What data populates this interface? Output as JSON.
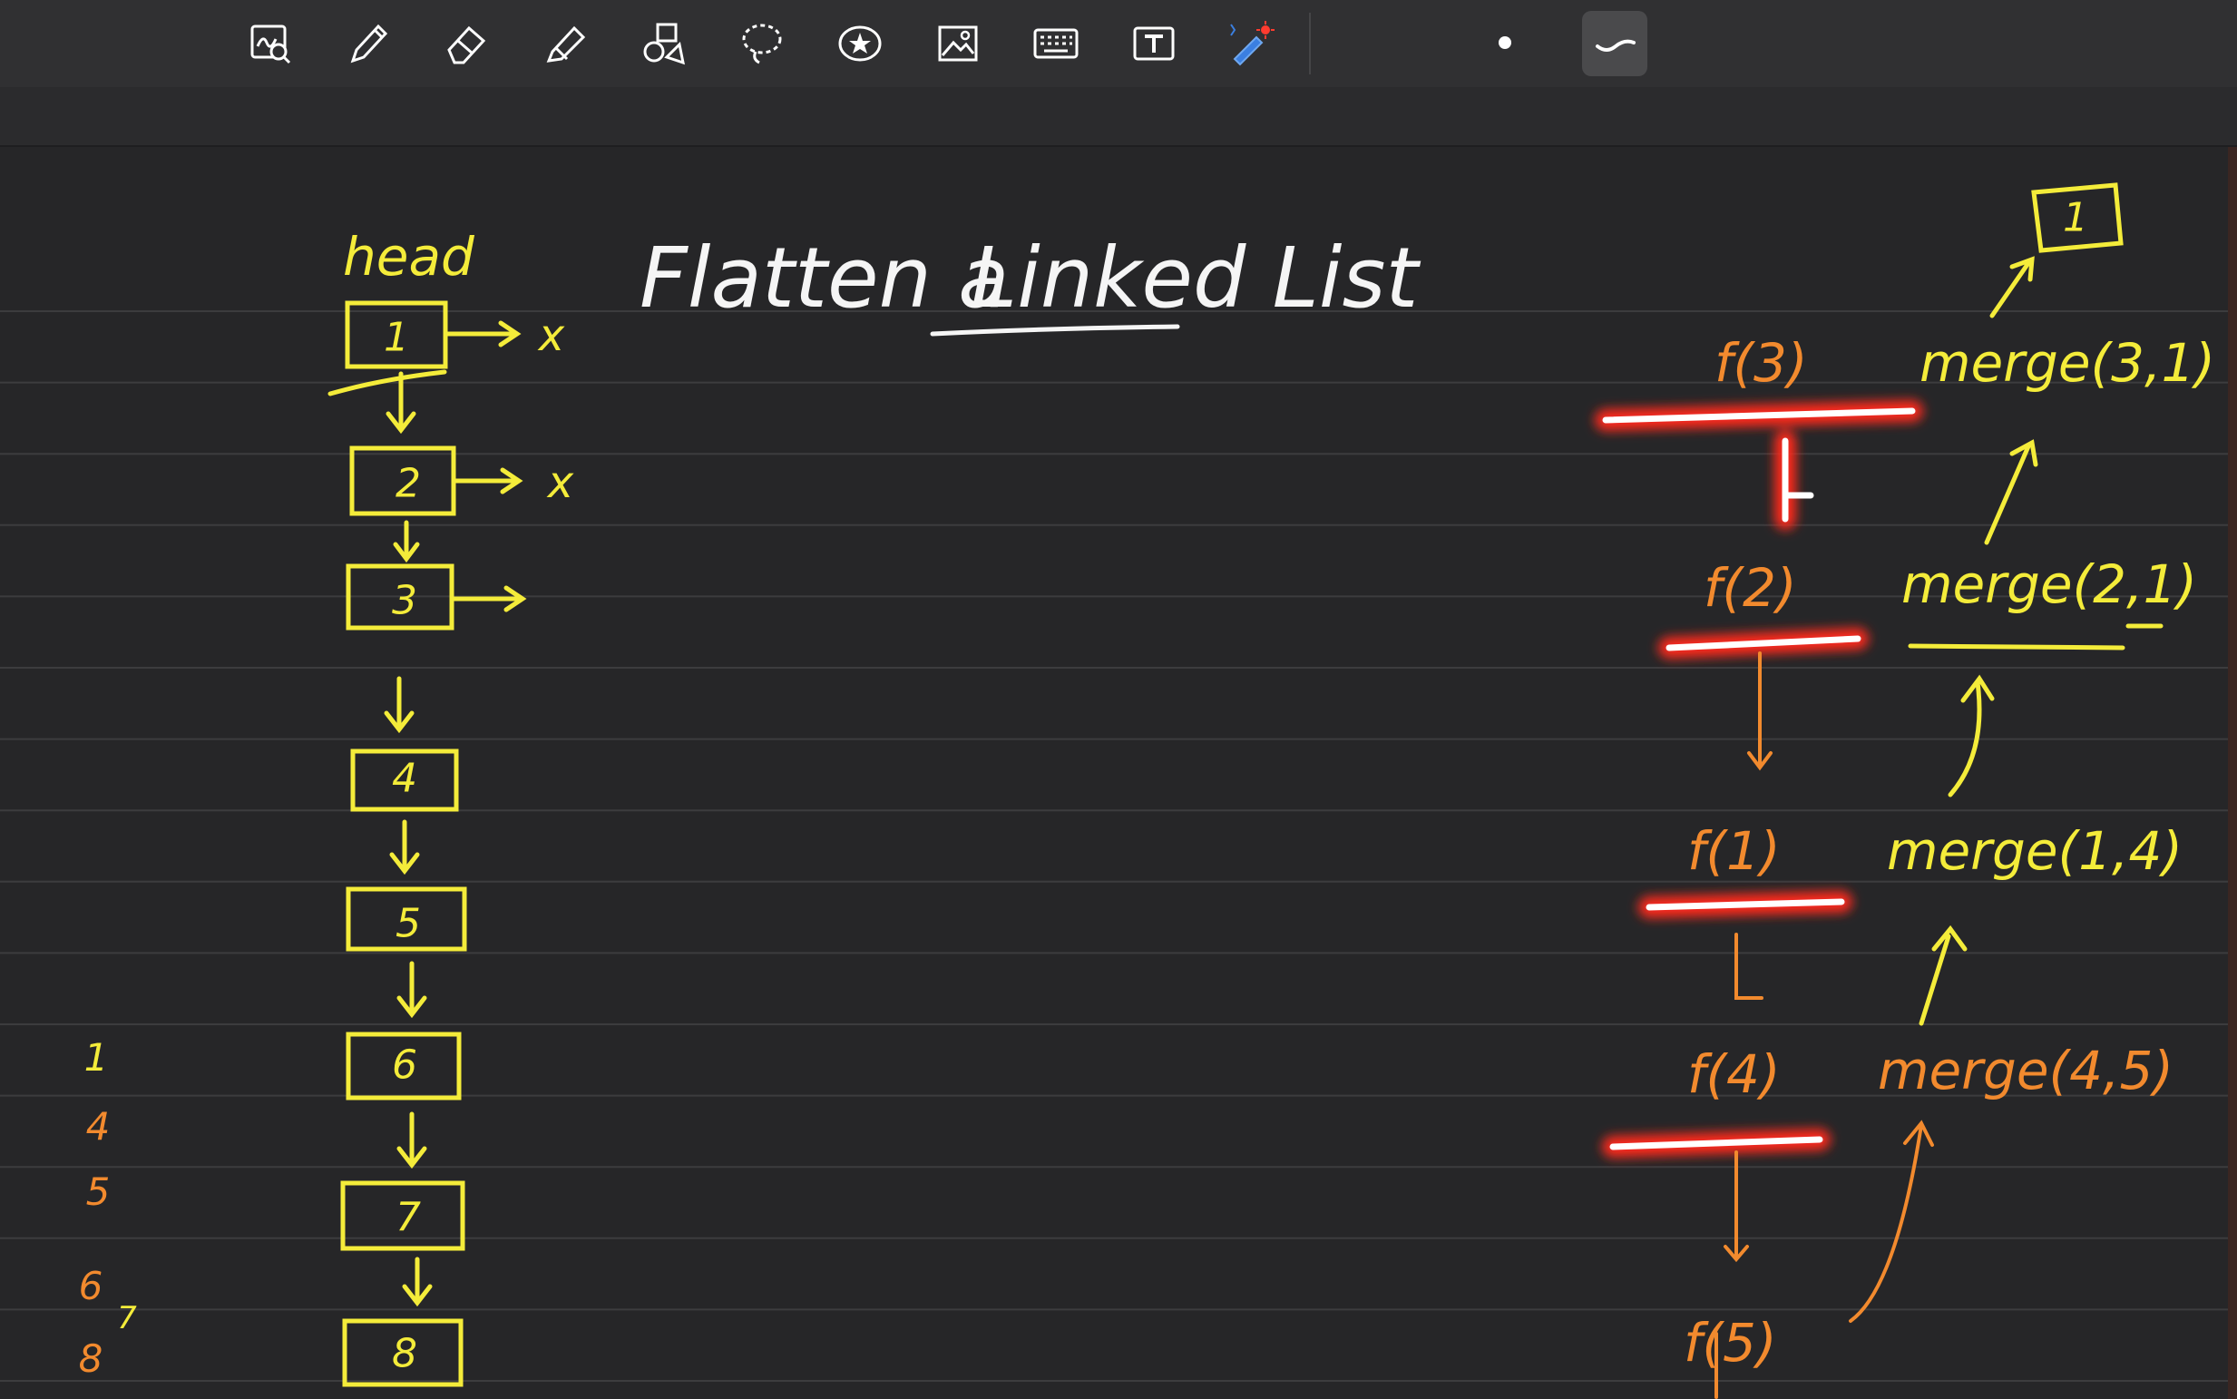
{
  "toolbar": {
    "tools": [
      {
        "name": "zoom-window-icon",
        "active": false
      },
      {
        "name": "pen-icon",
        "active": false
      },
      {
        "name": "eraser-icon",
        "active": false
      },
      {
        "name": "highlighter-icon",
        "active": false
      },
      {
        "name": "shapes-icon",
        "active": false
      },
      {
        "name": "lasso-icon",
        "active": false
      },
      {
        "name": "sticker-icon",
        "active": false
      },
      {
        "name": "image-icon",
        "active": false
      },
      {
        "name": "keyboard-icon",
        "active": false
      },
      {
        "name": "text-box-icon",
        "active": false
      },
      {
        "name": "laser-pointer-icon",
        "active": false
      },
      {
        "name": "stroke-size-icon",
        "active": false
      },
      {
        "name": "curve-stroke-icon",
        "active": true
      }
    ]
  },
  "colors": {
    "background": "#262628",
    "ruled_line": "#3c3c3e",
    "yellow_ink": "#f4ec3a",
    "orange_ink": "#f28a2e",
    "white_ink": "#f5f5f5",
    "laser_red": "#ff2a1f"
  },
  "canvas": {
    "title_part1": "Flatten a",
    "title_part2": "Linked List",
    "head_label": "head",
    "x_mark": "x",
    "nodes": [
      "1",
      "2",
      "3",
      "4",
      "5",
      "6",
      "7",
      "8"
    ],
    "side_numbers": [
      "1",
      "4",
      "5",
      "6",
      "7",
      "8"
    ],
    "calls": [
      "f(3)",
      "f(2)",
      "f(1)",
      "f(4)",
      "f(5)"
    ],
    "merges": [
      "merge(3,1)",
      "merge(2,1)",
      "merge(1,4)",
      "merge(4,5)"
    ],
    "result_box": "1"
  }
}
